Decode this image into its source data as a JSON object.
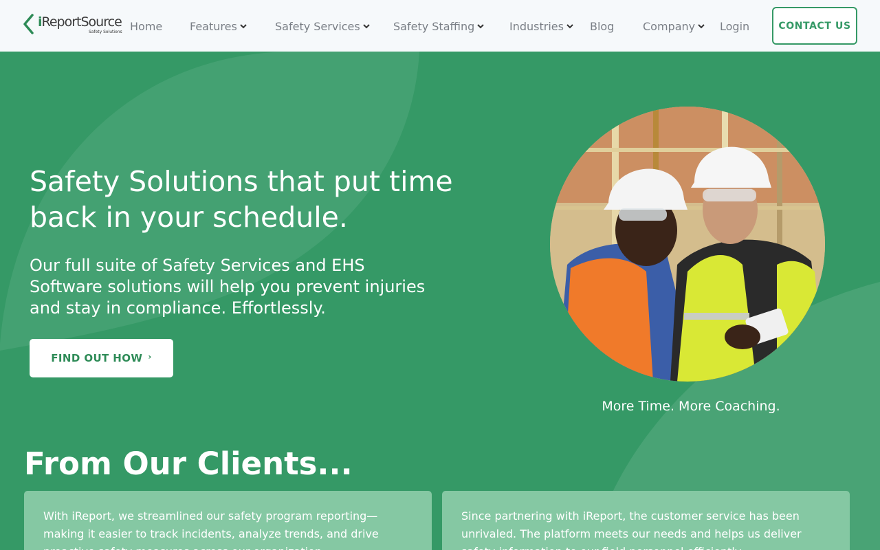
{
  "header": {
    "logo": {
      "word_i": "i",
      "word_rest": "ReportSource",
      "tagline": "Safety Solutions"
    },
    "nav": [
      {
        "label": "Home",
        "has_dropdown": false
      },
      {
        "label": "Features",
        "has_dropdown": true
      },
      {
        "label": "Safety Services",
        "has_dropdown": true
      },
      {
        "label": "Safety Staffing",
        "has_dropdown": true
      },
      {
        "label": "Industries",
        "has_dropdown": true
      },
      {
        "label": "Blog",
        "has_dropdown": false
      },
      {
        "label": "Company",
        "has_dropdown": true
      },
      {
        "label": "Login",
        "has_dropdown": false
      }
    ],
    "contact_label": "CONTACT US"
  },
  "hero": {
    "title": "Safety Solutions that put time back in your schedule.",
    "subtitle": "Our full suite of Safety Services and EHS Software solutions will help you prevent injuries and stay in compliance. Effortlessly.",
    "cta_label": "FIND OUT HOW",
    "cta_arrow": "›",
    "photo_caption": "More Time. More Coaching."
  },
  "clients": {
    "title": "From Our Clients...",
    "testimonials": [
      {
        "text": "With iReport, we streamlined our safety program reporting—making it easier to track incidents, analyze trends, and drive proactive safety measures across our organization."
      },
      {
        "text": "Since partnering with iReport, the customer service has been unrivaled. The platform meets our needs and helps us deliver safety information to our field personnel efficiently."
      }
    ]
  },
  "colors": {
    "brand_green": "#359966",
    "header_bg": "#f6f9fb",
    "card_bg": "#85c8a3",
    "nav_text": "#7a7f86"
  },
  "icons": {
    "dropdown": "chevron-down-icon",
    "logo_mark": "logo-chevron-icon"
  }
}
